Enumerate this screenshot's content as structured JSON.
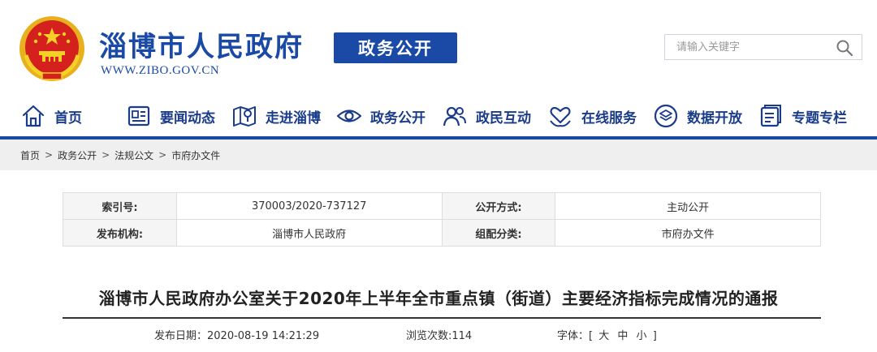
{
  "header": {
    "site_title": "淄博市人民政府",
    "site_url": "WWW.ZIBO.GOV.CN",
    "channel_badge": "政务公开",
    "search_placeholder": "请输入关键字",
    "brand_color": "#1a4aa6"
  },
  "nav": {
    "items": [
      {
        "label": "首页",
        "icon": "home-icon"
      },
      {
        "label": "要闻动态",
        "icon": "news-icon"
      },
      {
        "label": "走进淄博",
        "icon": "map-icon"
      },
      {
        "label": "政务公开",
        "icon": "eye-icon"
      },
      {
        "label": "政民互动",
        "icon": "people-icon"
      },
      {
        "label": "在线服务",
        "icon": "heart-hand-icon"
      },
      {
        "label": "数据开放",
        "icon": "layers-icon"
      },
      {
        "label": "专题专栏",
        "icon": "document-icon"
      }
    ]
  },
  "breadcrumb": {
    "items": [
      "首页",
      "政务公开",
      "法规公文",
      "市府办文件"
    ],
    "separator": ">"
  },
  "info_table": {
    "index_label": "索引号:",
    "index_value": "370003/2020-737127",
    "disclosure_label": "公开方式:",
    "disclosure_value": "主动公开",
    "publisher_label": "发布机构:",
    "publisher_value": "淄博市人民政府",
    "category_label": "组配分类:",
    "category_value": "市府办文件"
  },
  "article": {
    "title": "淄博市人民政府办公室关于2020年上半年全市重点镇（街道）主要经济指标完成情况的通报",
    "publish_label": "发布日期：",
    "publish_date": "2020-08-19 14:21:29",
    "views_label": "浏览次数:",
    "views": "114",
    "font_label": "字体：",
    "bracket_open": "[",
    "font_large": "大",
    "font_medium": "中",
    "font_small": "小",
    "bracket_close": "]"
  }
}
